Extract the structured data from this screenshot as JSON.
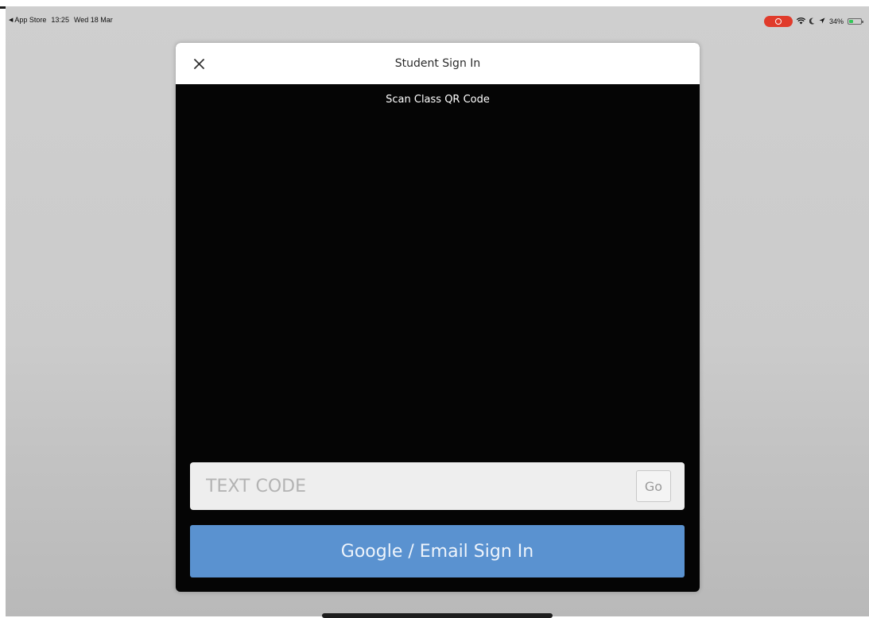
{
  "status_bar": {
    "back_app": "App Store",
    "time": "13:25",
    "date": "Wed 18 Mar",
    "battery": "34%",
    "battery_level": 0.34,
    "icons": [
      "back-arrow-icon",
      "screen-record-icon",
      "wifi-icon",
      "moon-icon",
      "location-icon",
      "battery-charging-icon"
    ]
  },
  "modal": {
    "title": "Student Sign In",
    "close_icon": "close-icon",
    "scan_label": "Scan Class QR Code",
    "code_input": {
      "placeholder": "TEXT CODE",
      "value": ""
    },
    "go_label": "Go",
    "google_button_label": "Google / Email Sign In"
  },
  "colors": {
    "modal_background": "#050505",
    "header_background": "#ffffff",
    "google_button": "#5a92d0",
    "record_indicator": "#e03b2b",
    "battery_charge": "#34c759"
  }
}
